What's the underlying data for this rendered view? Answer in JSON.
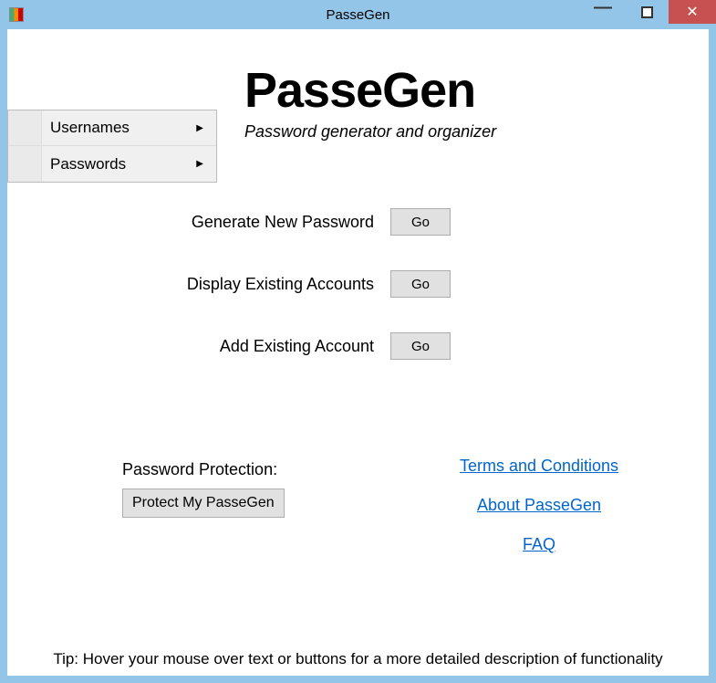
{
  "window": {
    "title": "PasseGen"
  },
  "menu": {
    "items": [
      {
        "label": "Usernames"
      },
      {
        "label": "Passwords"
      }
    ]
  },
  "header": {
    "title": "PasseGen",
    "subtitle": "Password generator and organizer"
  },
  "actions": [
    {
      "label": "Generate New Password",
      "button": "Go"
    },
    {
      "label": "Display Existing Accounts",
      "button": "Go"
    },
    {
      "label": "Add Existing Account",
      "button": "Go"
    }
  ],
  "protection": {
    "label": "Password Protection:",
    "button": "Protect My PasseGen"
  },
  "links": [
    {
      "label": "Terms and Conditions"
    },
    {
      "label": "About PasseGen"
    },
    {
      "label": "FAQ"
    }
  ],
  "tip": "Tip: Hover your mouse over text or buttons for a more detailed description of functionality"
}
